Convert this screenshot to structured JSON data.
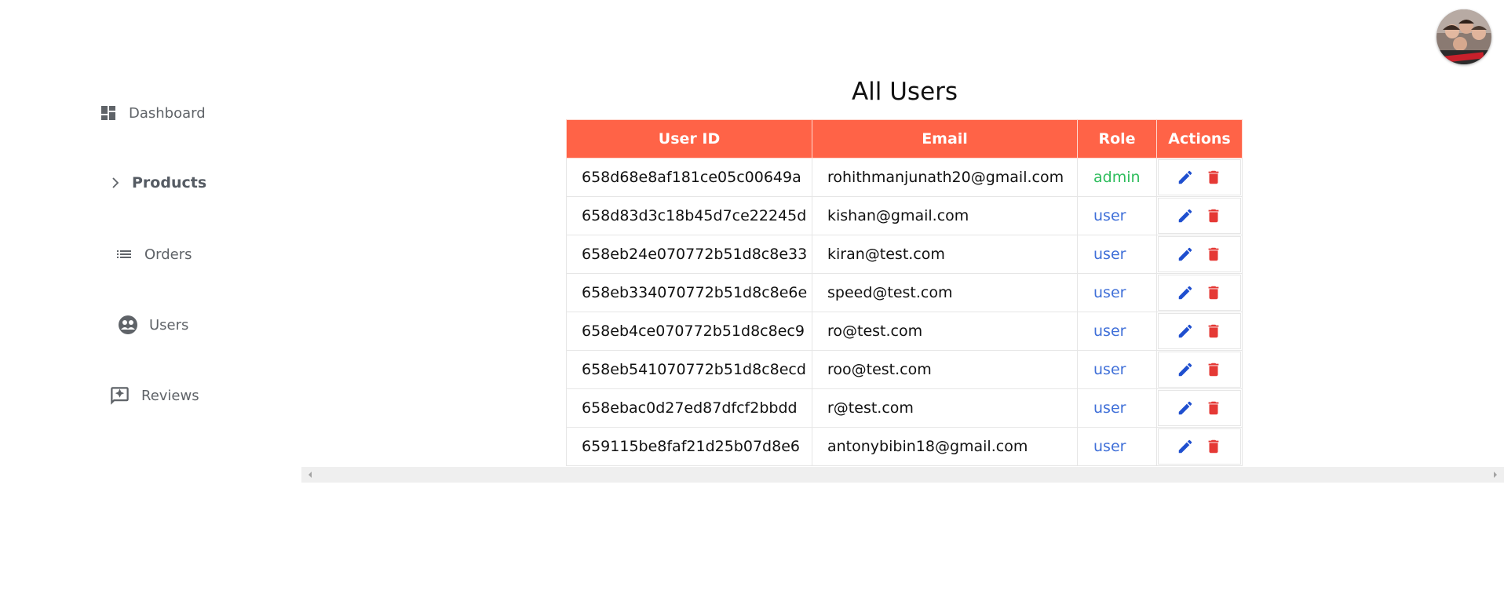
{
  "sidebar": {
    "items": [
      {
        "label": "Dashboard",
        "icon": "dashboard-icon"
      },
      {
        "label": "Products",
        "icon": "chevron-right-icon"
      },
      {
        "label": "Orders",
        "icon": "list-icon"
      },
      {
        "label": "Users",
        "icon": "users-icon"
      },
      {
        "label": "Reviews",
        "icon": "review-icon"
      }
    ]
  },
  "header": {
    "title": "All Users",
    "avatar_icon": "user-avatar"
  },
  "table": {
    "columns": [
      "User ID",
      "Email",
      "Role",
      "Actions"
    ],
    "rows": [
      {
        "id": "658d68e8af181ce05c00649a",
        "email": "rohithmanjunath20@gmail.com",
        "role": "admin"
      },
      {
        "id": "658d83d3c18b45d7ce22245d",
        "email": "kishan@gmail.com",
        "role": "user"
      },
      {
        "id": "658eb24e070772b51d8c8e33",
        "email": "kiran@test.com",
        "role": "user"
      },
      {
        "id": "658eb334070772b51d8c8e6e",
        "email": "speed@test.com",
        "role": "user"
      },
      {
        "id": "658eb4ce070772b51d8c8ec9",
        "email": "ro@test.com",
        "role": "user"
      },
      {
        "id": "658eb541070772b51d8c8ecd",
        "email": "roo@test.com",
        "role": "user"
      },
      {
        "id": "658ebac0d27ed87dfcf2bbdd",
        "email": "r@test.com",
        "role": "user"
      },
      {
        "id": "659115be8faf21d25b07d8e6",
        "email": "antonybibin18@gmail.com",
        "role": "user"
      }
    ],
    "action_icons": [
      "edit-icon",
      "delete-icon"
    ]
  },
  "colors": {
    "header_bg": "#ff6347",
    "admin": "#2dbd5c",
    "user": "#3f6fd8",
    "edit": "#1f4fcf",
    "delete": "#e53935"
  }
}
